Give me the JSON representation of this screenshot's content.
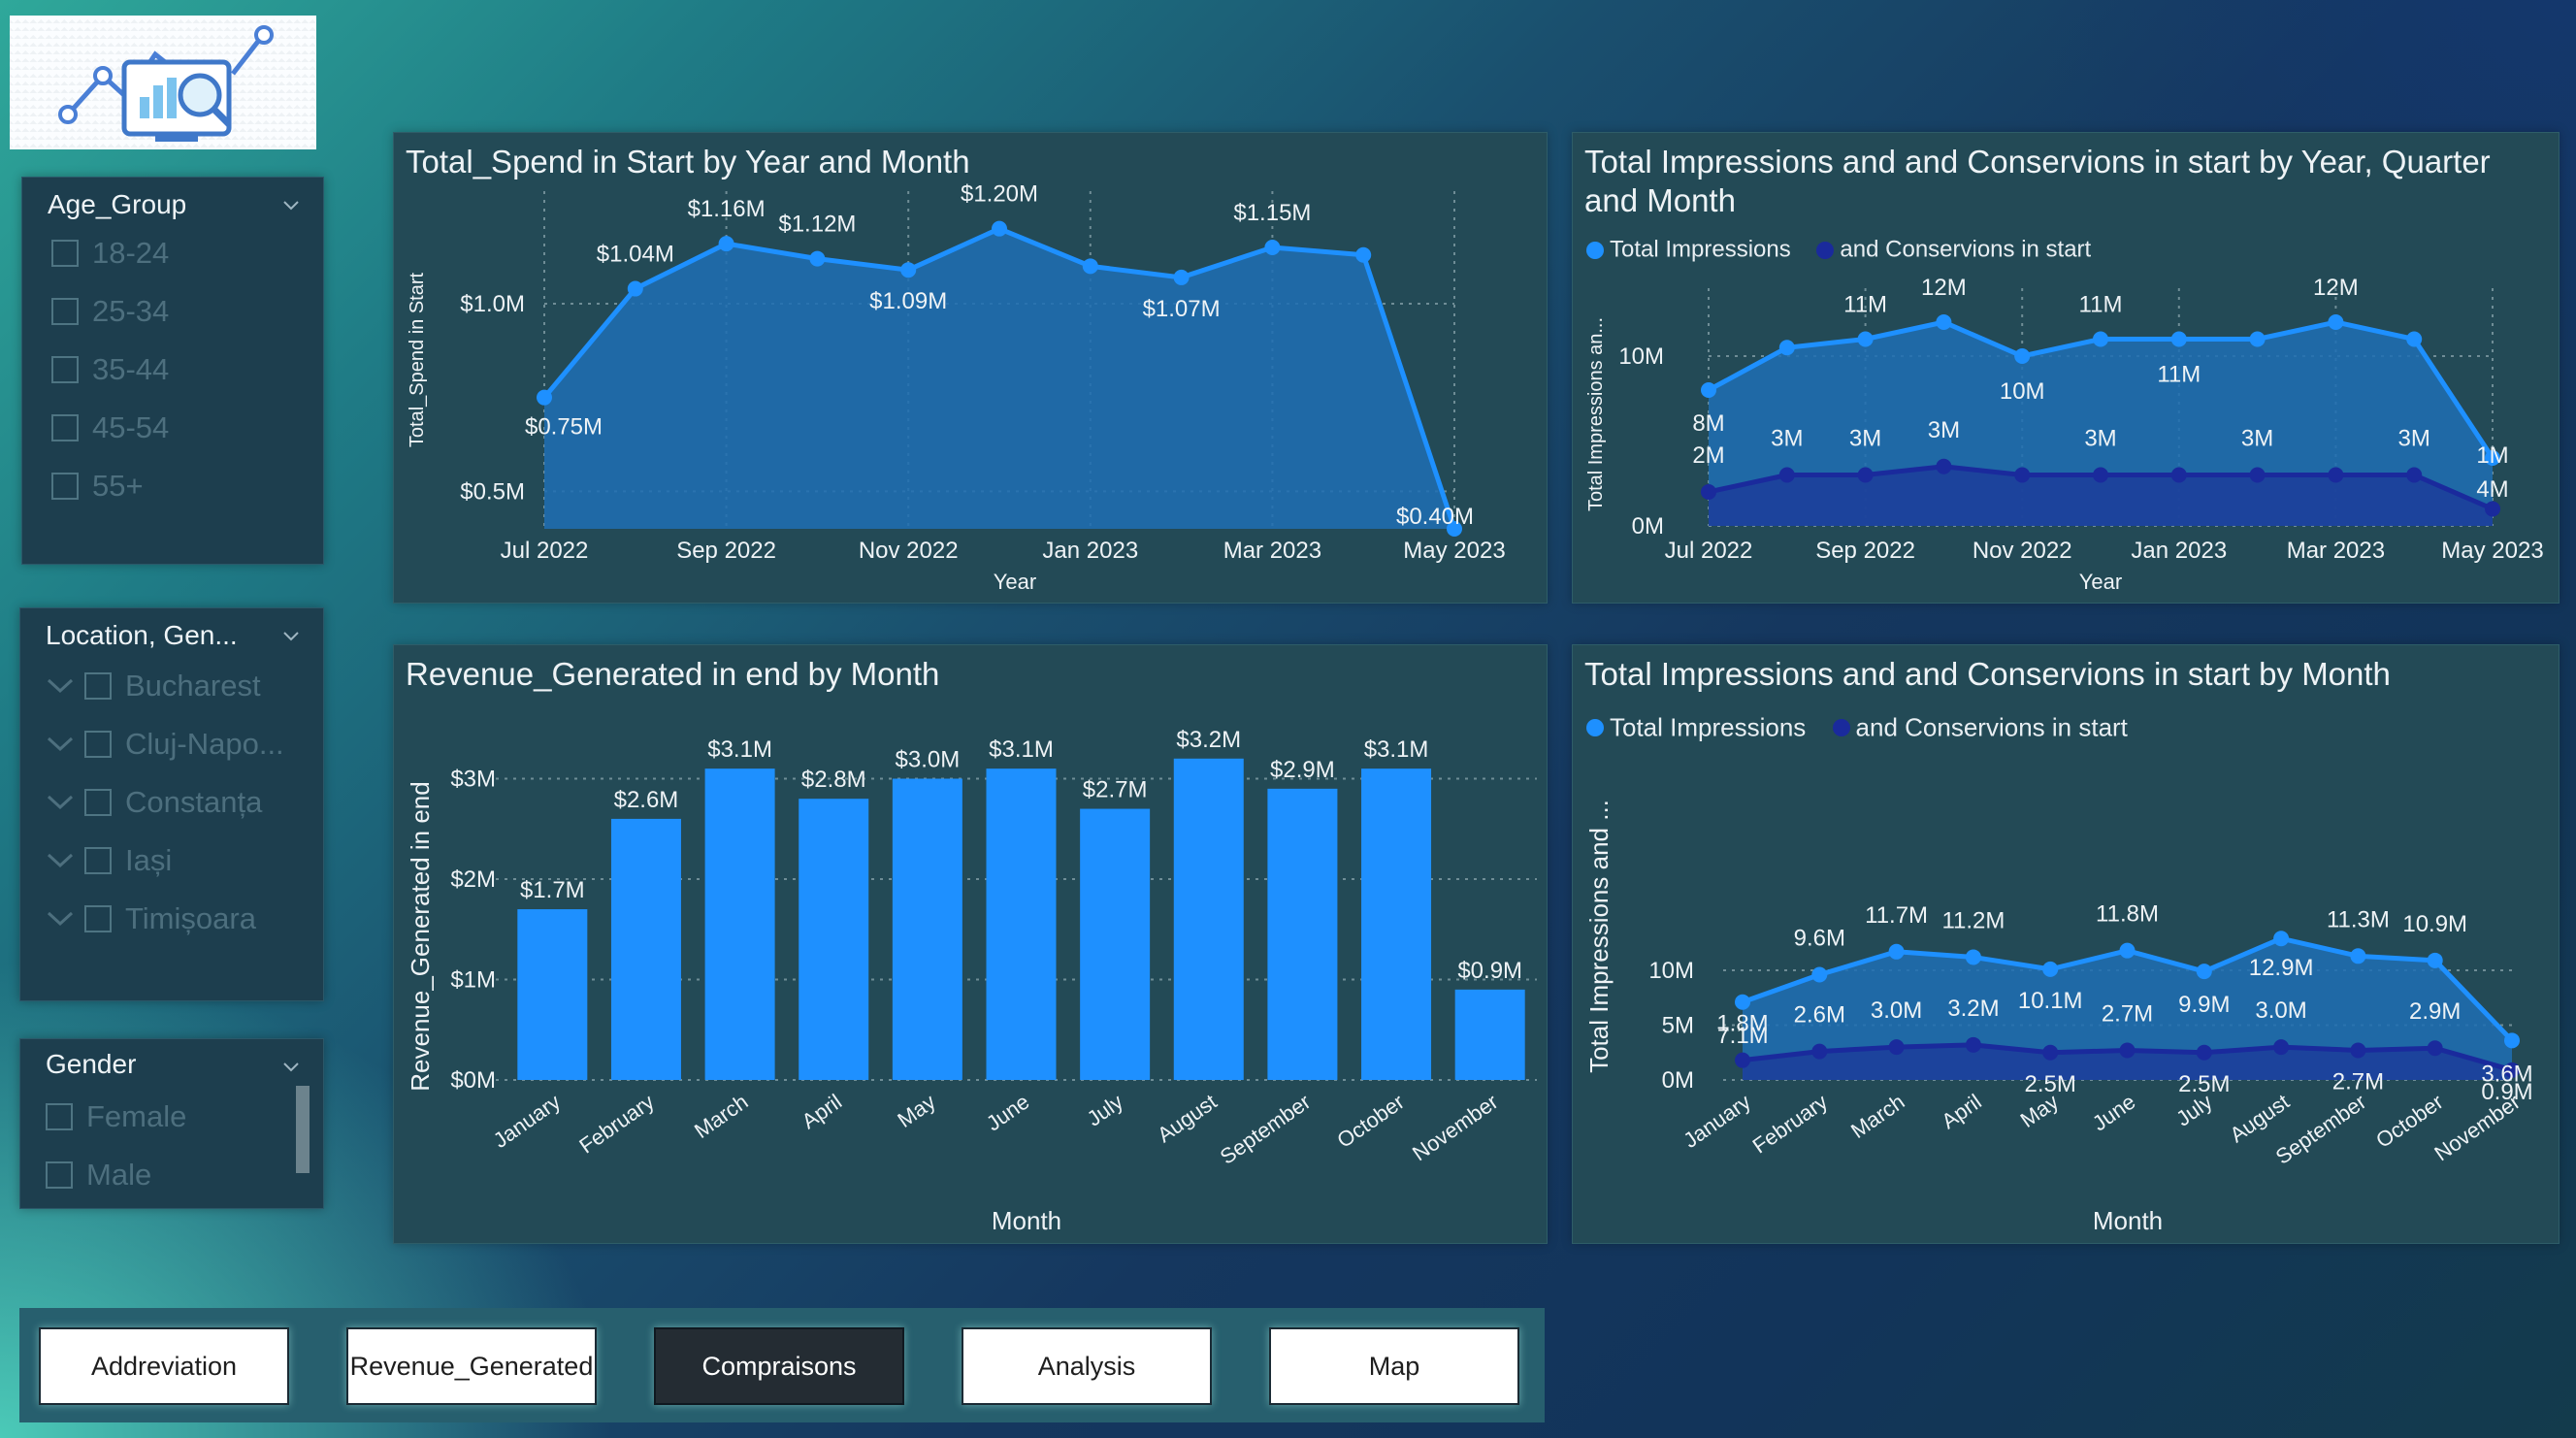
{
  "slicers": {
    "age": {
      "title": "Age_Group",
      "items": [
        "18-24",
        "25-34",
        "35-44",
        "45-54",
        "55+"
      ]
    },
    "location": {
      "title": "Location, Gen...",
      "items": [
        "Bucharest",
        "Cluj-Napo...",
        "Constanța",
        "Iași",
        "Timișoara"
      ]
    },
    "gender": {
      "title": "Gender",
      "items": [
        "Female",
        "Male"
      ]
    }
  },
  "nav": {
    "buttons": [
      "Addreviation",
      "Revenue_Generated",
      "Compraisons",
      "Analysis",
      "Map"
    ],
    "active": "Compraisons"
  },
  "colors": {
    "light_series": "#1e90ff",
    "dark_series": "#1a2a9c",
    "active_button": "#242c33"
  },
  "chart_data": [
    {
      "type": "area",
      "title": "Total_Spend in Start by Year and Month",
      "xlabel": "Year",
      "ylabel": "Total_Spend in Start",
      "x_ticks": [
        "Jul 2022",
        "Sep 2022",
        "Nov 2022",
        "Jan 2023",
        "Mar 2023",
        "May 2023"
      ],
      "y_ticks": [
        "$0.5M",
        "$1.0M"
      ],
      "ylim": [
        0.4,
        1.3
      ],
      "x": [
        "Jul 2022",
        "Aug 2022",
        "Sep 2022",
        "Oct 2022",
        "Nov 2022",
        "Dec 2022",
        "Jan 2023",
        "Feb 2023",
        "Mar 2023",
        "Apr 2023",
        "May 2023"
      ],
      "values": [
        0.75,
        1.04,
        1.16,
        1.12,
        1.09,
        1.2,
        1.1,
        1.07,
        1.15,
        1.13,
        0.4
      ],
      "labels": [
        "$0.75M",
        "$1.04M",
        "$1.16M",
        "$1.12M",
        "$1.09M",
        "$1.20M",
        "",
        "$1.07M",
        "$1.15M",
        "",
        "$0.40M"
      ]
    },
    {
      "type": "area",
      "title": "Total Impressions and and Conservions in start by Year, Quarter and Month",
      "xlabel": "Year",
      "ylabel": "Total Impressions an...",
      "x_ticks": [
        "Jul 2022",
        "Sep 2022",
        "Nov 2022",
        "Jan 2023",
        "Mar 2023",
        "May 2023"
      ],
      "y_ticks": [
        "0M",
        "10M"
      ],
      "ylim": [
        0,
        14
      ],
      "x": [
        "Jul 2022",
        "Aug 2022",
        "Sep 2022",
        "Oct 2022",
        "Nov 2022",
        "Dec 2022",
        "Jan 2023",
        "Feb 2023",
        "Mar 2023",
        "Apr 2023",
        "May 2023"
      ],
      "legend": [
        "Total Impressions",
        "and Conservions in start"
      ],
      "series": [
        {
          "name": "Total Impressions",
          "values": [
            8,
            10.5,
            11,
            12,
            10,
            11,
            11,
            11,
            12,
            11,
            4
          ],
          "labels": [
            "8M",
            "",
            "11M",
            "12M",
            "10M",
            "11M",
            "11M",
            "",
            "12M",
            "",
            "4M"
          ]
        },
        {
          "name": "and Conservions in start",
          "values": [
            2,
            3,
            3,
            3.5,
            3,
            3,
            3,
            3,
            3,
            3,
            1
          ],
          "labels": [
            "2M",
            "3M",
            "3M",
            "3M",
            "",
            "3M",
            "",
            "3M",
            "",
            "3M",
            "1M"
          ]
        }
      ]
    },
    {
      "type": "bar",
      "title": "Revenue_Generated in end by Month",
      "xlabel": "Month",
      "ylabel": "Revenue_Generated in end",
      "y_ticks": [
        "$0M",
        "$1M",
        "$2M",
        "$3M"
      ],
      "ylim": [
        0,
        3.3
      ],
      "categories": [
        "January",
        "February",
        "March",
        "April",
        "May",
        "June",
        "July",
        "August",
        "September",
        "October",
        "November"
      ],
      "values": [
        1.7,
        2.6,
        3.1,
        2.8,
        3.0,
        3.1,
        2.7,
        3.2,
        2.9,
        3.1,
        0.9
      ],
      "labels": [
        "$1.7M",
        "$2.6M",
        "$3.1M",
        "$2.8M",
        "$3.0M",
        "$3.1M",
        "$2.7M",
        "$3.2M",
        "$2.9M",
        "$3.1M",
        "$0.9M"
      ]
    },
    {
      "type": "area",
      "title": "Total Impressions and and Conservions in start by Month",
      "xlabel": "Month",
      "ylabel": "Total Impressions and ...",
      "y_ticks": [
        "0M",
        "5M",
        "10M"
      ],
      "ylim": [
        0,
        13.5
      ],
      "categories": [
        "January",
        "February",
        "March",
        "April",
        "May",
        "June",
        "July",
        "August",
        "September",
        "October",
        "November"
      ],
      "legend": [
        "Total Impressions",
        "and Conservions in start"
      ],
      "series": [
        {
          "name": "Total Impressions",
          "values": [
            7.1,
            9.6,
            11.7,
            11.2,
            10.1,
            11.8,
            9.9,
            12.9,
            11.3,
            10.9,
            3.6
          ],
          "labels": [
            "7.1M",
            "9.6M",
            "11.7M",
            "11.2M",
            "10.1M",
            "11.8M",
            "9.9M",
            "12.9M",
            "11.3M",
            "10.9M",
            "3.6M"
          ]
        },
        {
          "name": "and Conservions in start",
          "values": [
            1.8,
            2.6,
            3.0,
            3.2,
            2.5,
            2.7,
            2.5,
            3.0,
            2.7,
            2.9,
            0.9
          ],
          "labels": [
            "1.8M",
            "2.6M",
            "3.0M",
            "3.2M",
            "2.5M",
            "2.7M",
            "2.5M",
            "3.0M",
            "2.7M",
            "2.9M",
            "0.9M"
          ]
        }
      ]
    }
  ]
}
